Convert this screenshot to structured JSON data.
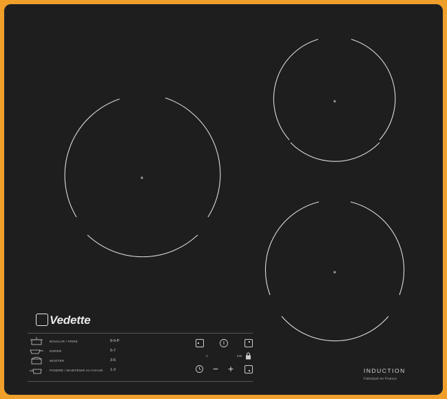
{
  "brand": {
    "name": "Vedette"
  },
  "cooking_guide": [
    {
      "label": "BOUILLIR / FRIRE",
      "value": "8-9-P"
    },
    {
      "label": "DORER",
      "value": "5-7"
    },
    {
      "label": "MIJOTER",
      "value": "3-5"
    },
    {
      "label": "FONDRE / MAINTENIR AU CHAUD",
      "value": "1-2"
    }
  ],
  "controls": {
    "level_indicator": ".ıl",
    "lock_label": "min",
    "minus": "−",
    "plus": "+"
  },
  "product": {
    "type_label": "INDUCTION",
    "origin_label": "Fabriqué en France"
  },
  "colors": {
    "background": "#f0a02a",
    "glass": "#1e1e1f",
    "lines": "#dcdcdc"
  }
}
